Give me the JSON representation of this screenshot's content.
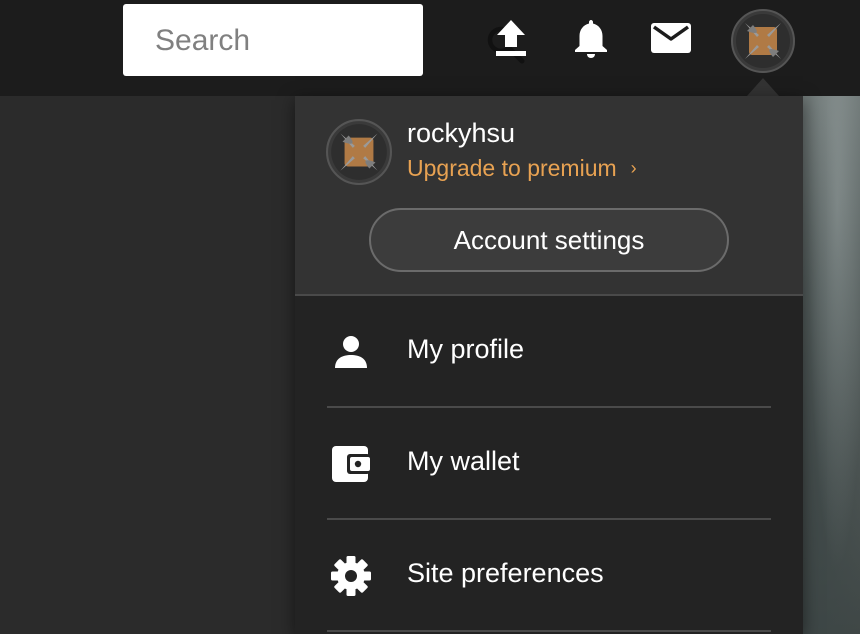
{
  "search": {
    "placeholder": "Search",
    "button_icon": "search-icon"
  },
  "topbar": {
    "icons": [
      "upload-icon",
      "bell-icon",
      "mail-icon"
    ],
    "avatar_icon": "avatar"
  },
  "account_menu": {
    "username": "rockyhsu",
    "upgrade_label": "Upgrade to premium",
    "upgrade_chevron": "›",
    "account_settings_label": "Account settings",
    "items": [
      {
        "label": "My profile",
        "icon": "person-icon"
      },
      {
        "label": "My wallet",
        "icon": "wallet-icon"
      },
      {
        "label": "Site preferences",
        "icon": "gear-icon"
      }
    ]
  },
  "colors": {
    "topbar_bg": "#1c1c1c",
    "menu_bg": "#232323",
    "menu_header_bg": "#333333",
    "accent": "#e8a252",
    "text": "#ffffff"
  }
}
